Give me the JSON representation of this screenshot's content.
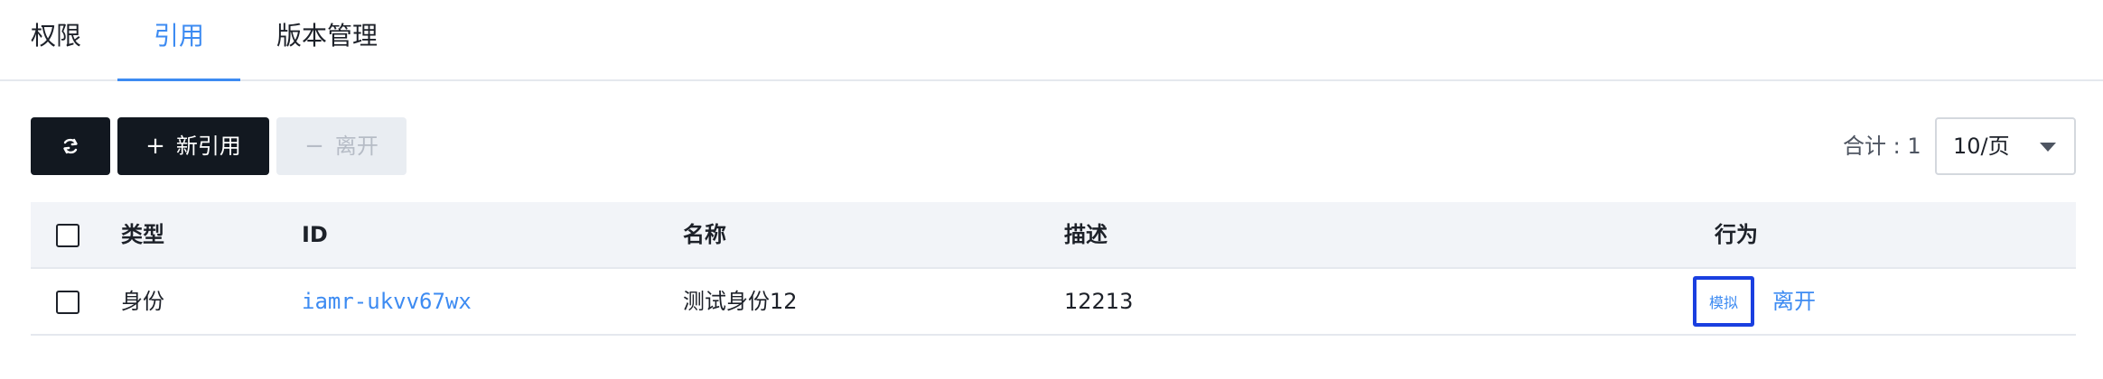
{
  "tabs": [
    {
      "label": "权限",
      "active": false
    },
    {
      "label": "引用",
      "active": true
    },
    {
      "label": "版本管理",
      "active": false
    }
  ],
  "toolbar": {
    "refresh_icon": "refresh-icon",
    "new_ref_symbol": "+",
    "new_ref_label": "新引用",
    "leave_symbol": "−",
    "leave_label": "离开",
    "total_label": "合计 : 1",
    "page_size": "10/页"
  },
  "table": {
    "headers": {
      "type": "类型",
      "id": "ID",
      "name": "名称",
      "description": "描述",
      "action": "行为"
    },
    "rows": [
      {
        "type": "身份",
        "id": "iamr-ukvv67wx",
        "name": "测试身份12",
        "description": "12213",
        "action_simulate": "模拟",
        "action_leave": "离开"
      }
    ]
  },
  "colors": {
    "accent": "#3d8bf2",
    "dark_button": "#121820",
    "highlight_border": "#1a3fe0"
  }
}
